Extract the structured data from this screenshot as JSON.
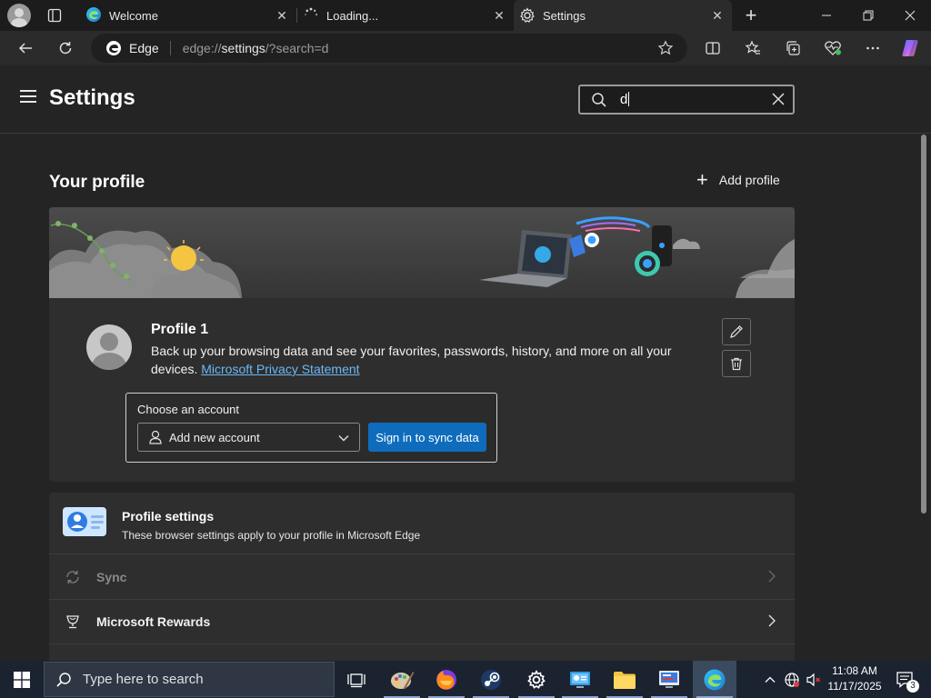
{
  "tabs": [
    {
      "title": "Welcome",
      "state": "inactive"
    },
    {
      "title": "Loading...",
      "state": "loading"
    },
    {
      "title": "Settings",
      "state": "active"
    }
  ],
  "address_bar": {
    "site_label": "Edge",
    "url_scheme": "edge://",
    "url_host": "settings",
    "url_rest": "/?search=d"
  },
  "settings": {
    "title": "Settings",
    "search_value": "d"
  },
  "profile_section": {
    "title": "Your profile",
    "add_profile_label": "Add profile",
    "profile_name": "Profile 1",
    "description": "Back up your browsing data and see your favorites, passwords, history, and more on all your devices.",
    "privacy_link": "Microsoft Privacy Statement",
    "account_label": "Choose an account",
    "account_selected": "Add new account",
    "sync_button": "Sign in to sync data"
  },
  "list": {
    "profile_settings_title": "Profile settings",
    "profile_settings_desc": "These browser settings apply to your profile in Microsoft Edge",
    "items": [
      {
        "label": "Sync",
        "enabled": false
      },
      {
        "label": "Microsoft Rewards",
        "enabled": true
      }
    ]
  },
  "taskbar": {
    "search_placeholder": "Type here to search",
    "time": "11:08 AM",
    "date": "11/17/2025",
    "notification_count": "3"
  },
  "colors": {
    "accent": "#0f6cbd",
    "link": "#6cb8f6",
    "page_bg": "#242424",
    "card_bg": "#2e2e2e"
  }
}
